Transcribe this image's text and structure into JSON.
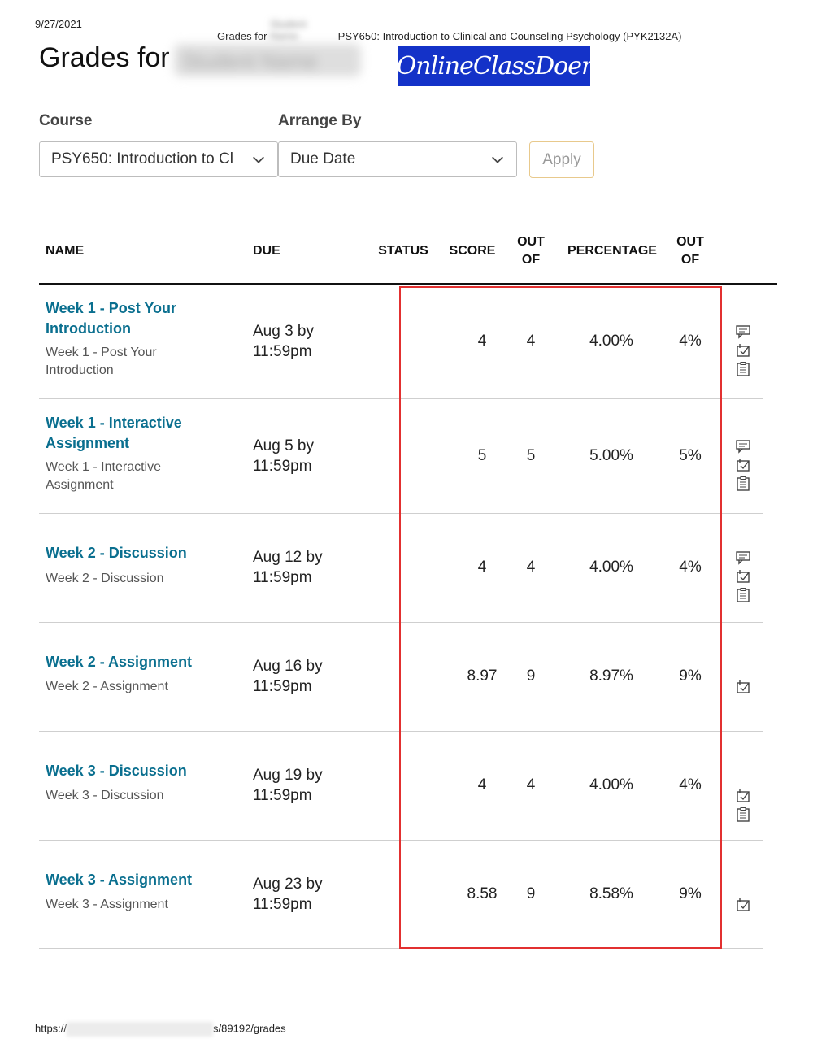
{
  "print_header": {
    "date": "9/27/2021",
    "title_prefix": "Grades for",
    "redacted_name": "Student Name",
    "course_full": "PSY650: Introduction to Clinical and Counseling Psychology (PYK2132A)"
  },
  "page": {
    "title": "Grades for",
    "redacted_name": "Student Name",
    "logo_text": "OnlineClassDoer"
  },
  "filters": {
    "course_label": "Course",
    "course_value": "PSY650: Introduction to Cl",
    "arrange_label": "Arrange By",
    "arrange_value": "Due Date",
    "apply_label": "Apply"
  },
  "table": {
    "headers": {
      "name": "NAME",
      "due": "DUE",
      "status": "STATUS",
      "score": "SCORE",
      "out_of_1": "OUT OF",
      "percentage": "PERCENTAGE",
      "out_of_2": "OUT OF"
    },
    "rows": [
      {
        "name": "Week 1 - Post Your Introduction",
        "sub": "Week 1 - Post Your Introduction",
        "due": "Aug 3 by 11:59pm",
        "score": "4",
        "out_of": "4",
        "percentage": "4.00%",
        "weight": "4%",
        "icons": [
          "comment-icon",
          "rubric-check-icon",
          "rubric-list-icon"
        ]
      },
      {
        "name": "Week 1 - Interactive Assignment",
        "sub": "Week 1 - Interactive Assignment",
        "due": "Aug 5 by 11:59pm",
        "score": "5",
        "out_of": "5",
        "percentage": "5.00%",
        "weight": "5%",
        "icons": [
          "comment-icon",
          "rubric-check-icon",
          "rubric-list-icon"
        ]
      },
      {
        "name": "Week 2 - Discussion",
        "sub": "Week 2 - Discussion",
        "due": "Aug 12 by 11:59pm",
        "score": "4",
        "out_of": "4",
        "percentage": "4.00%",
        "weight": "4%",
        "icons": [
          "comment-icon",
          "rubric-check-icon",
          "rubric-list-icon"
        ]
      },
      {
        "name": "Week 2 - Assignment",
        "sub": "Week 2 - Assignment",
        "due": "Aug 16 by 11:59pm",
        "score": "8.97",
        "out_of": "9",
        "percentage": "8.97%",
        "weight": "9%",
        "icons": [
          "rubric-check-icon"
        ]
      },
      {
        "name": "Week 3 - Discussion",
        "sub": "Week 3 - Discussion",
        "due": "Aug 19 by 11:59pm",
        "score": "4",
        "out_of": "4",
        "percentage": "4.00%",
        "weight": "4%",
        "icons": [
          "rubric-check-icon",
          "rubric-list-icon"
        ]
      },
      {
        "name": "Week 3 - Assignment",
        "sub": "Week 3 - Assignment",
        "due": "Aug 23 by 11:59pm",
        "score": "8.58",
        "out_of": "9",
        "percentage": "8.58%",
        "weight": "9%",
        "icons": [
          "rubric-check-icon"
        ]
      }
    ]
  },
  "footer": {
    "url_prefix": "https://",
    "url_suffix": "s/89192/grades"
  },
  "colors": {
    "link": "#0a6f8f",
    "highlight_box": "#e23030",
    "apply_border": "#e8c98c",
    "logo_bg": "#1432c8"
  }
}
